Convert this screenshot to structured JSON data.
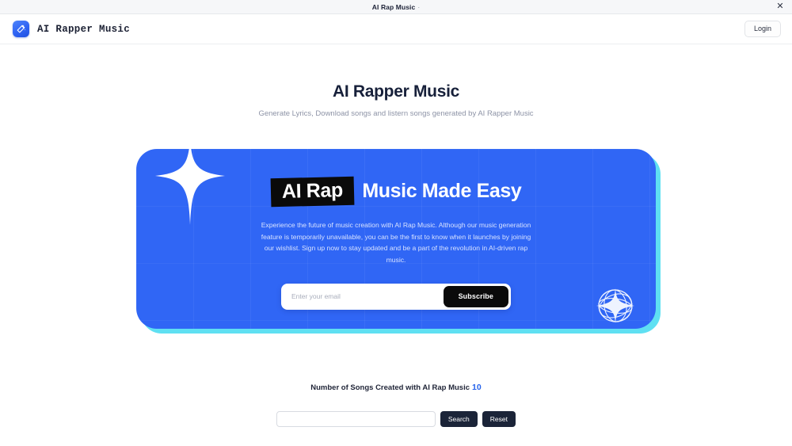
{
  "browser": {
    "tab_title": "AI Rap Music",
    "tab_title_suffix": "·",
    "close_icon": "close-icon",
    "close_glyph": "✕"
  },
  "header": {
    "logo_icon": "magic-wand-icon",
    "brand_name": "AI Rapper Music",
    "login_label": "Login"
  },
  "intro": {
    "title": "AI Rapper Music",
    "subtitle": "Generate Lyrics, Download songs and listern songs generated by AI Rapper Music"
  },
  "promo": {
    "heading_highlight": "AI Rap",
    "heading_rest": "Music Made Easy",
    "paragraph": "Experience the future of music creation with AI Rap Music. Although our music generation feature is temporarily unavailable, you can be the first to know when it launches by joining our wishlist. Sign up now to stay updated and be a part of the revolution in AI-driven rap music.",
    "email_placeholder": "Enter your email",
    "email_value": "",
    "subscribe_label": "Subscribe",
    "sparkle_icon": "sparkle-icon",
    "scribble_sparkle_icon": "scribble-sparkle-icon",
    "card_color": "#3066F5",
    "shadow_color": "#5FE0F2",
    "highlight_color": "#0A0A0A"
  },
  "stats": {
    "label": "Number of Songs Created with AI Rap Music",
    "count": "10",
    "count_color": "#2563EB"
  },
  "search": {
    "value": "",
    "placeholder": "",
    "search_label": "Search",
    "reset_label": "Reset"
  }
}
